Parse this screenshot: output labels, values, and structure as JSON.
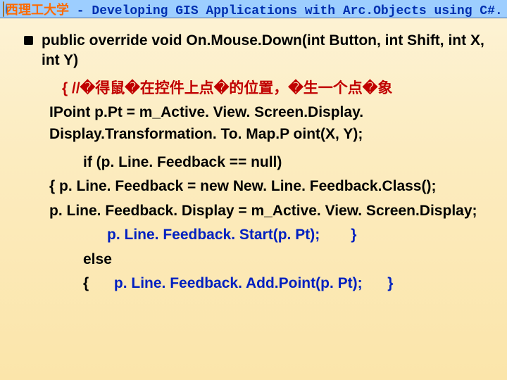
{
  "header": {
    "uni": "西理工大学",
    "dash": " - ",
    "course": "Developing GIS Applications with Arc.Objects using C#. NE"
  },
  "signature": "public override void On.Mouse.Down(int Button, int Shift, int X, int Y)",
  "lines": {
    "brace_comment": "{   //�得鼠�在控件上点�的位置，�生一个点�象",
    "pt_assign": "IPoint p.Pt = m_Active. View. Screen.Display. Display.Transformation. To. Map.P oint(X, Y);",
    "if_cond": "if (p. Line. Feedback == null)",
    "if_open_new": "{    p. Line. Feedback = new New. Line. Feedback.Class();",
    "disp_assign": "p. Line. Feedback. Display = m_Active. View. Screen.Display;",
    "start_call": "p. Line. Feedback. Start(p. Pt);",
    "close_brace": "}",
    "else_kw": "else",
    "else_open": "{",
    "addpoint": "p. Line. Feedback. Add.Point(p. Pt);",
    "close_brace2": "}"
  }
}
